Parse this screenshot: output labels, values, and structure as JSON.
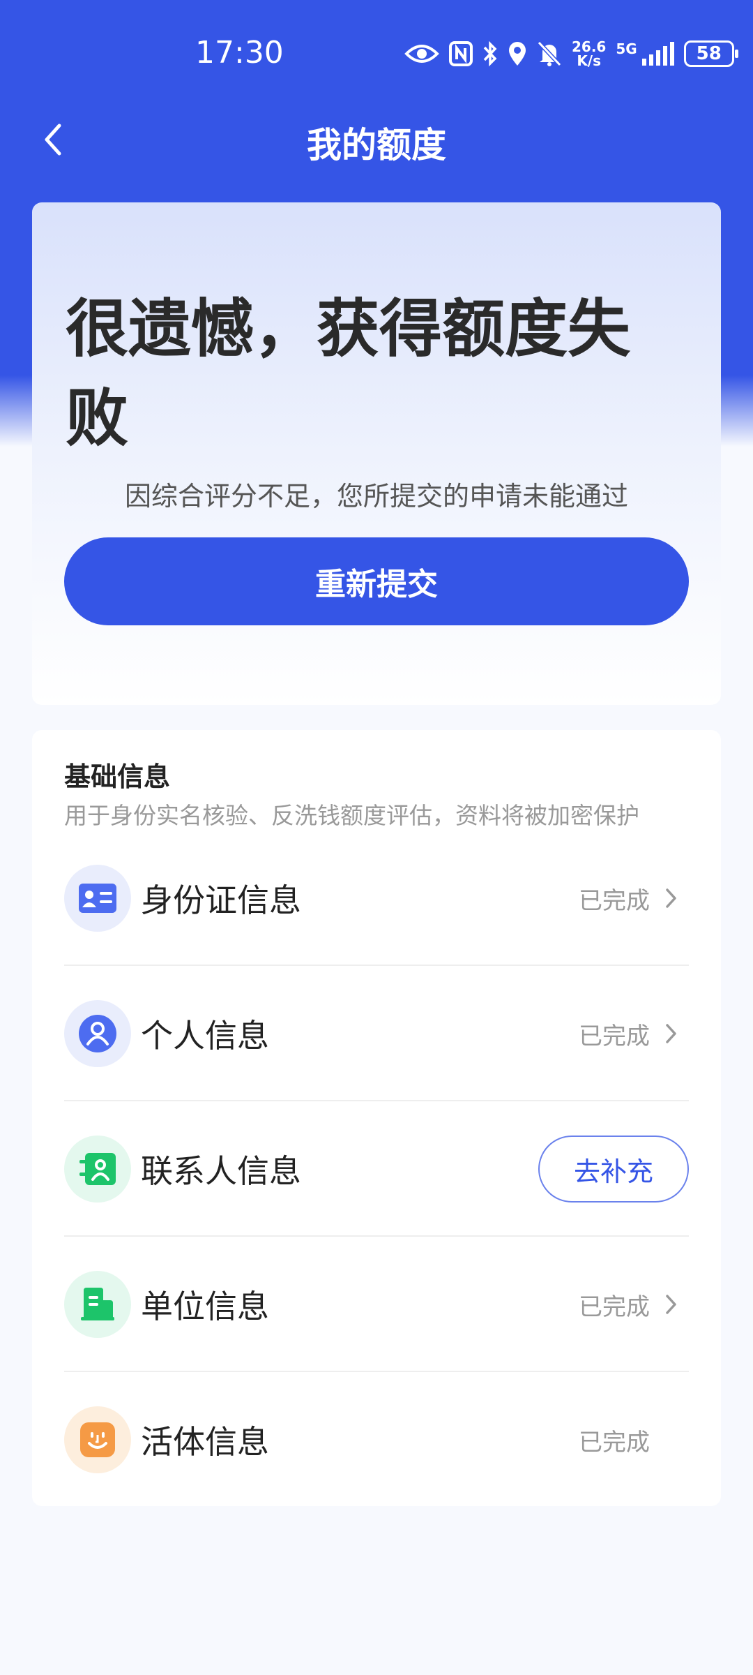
{
  "status_bar": {
    "time": "17:30",
    "net_speed_value": "26.6",
    "net_speed_unit": "K/s",
    "network": "5G",
    "battery": "58",
    "icons": [
      "eye-icon",
      "nfc-icon",
      "bluetooth-icon",
      "location-icon",
      "mute-icon",
      "signal-icon",
      "battery-icon"
    ]
  },
  "header": {
    "title": "我的额度",
    "back_icon": "chevron-left-icon"
  },
  "result": {
    "title": "很遗憾，获得额度失败",
    "subtitle": "因综合评分不足，您所提交的申请未能通过",
    "resubmit_label": "重新提交"
  },
  "basic_info": {
    "title": "基础信息",
    "description": "用于身份实名核验、反洗钱额度评估，资料将被加密保护",
    "items": [
      {
        "label": "身份证信息",
        "status": "已完成",
        "icon": "id-card-icon"
      },
      {
        "label": "个人信息",
        "status": "已完成",
        "icon": "person-icon"
      },
      {
        "label": "联系人信息",
        "action": "去补充",
        "icon": "contacts-icon"
      },
      {
        "label": "单位信息",
        "status": "已完成",
        "icon": "building-icon"
      },
      {
        "label": "活体信息",
        "status": "已完成",
        "icon": "face-icon"
      }
    ]
  },
  "colors": {
    "primary": "#3555e6",
    "icon_blue_bg": "#e9edfc",
    "icon_green_bg": "#e4f8ee",
    "icon_orange_bg": "#fdeedd",
    "green": "#1dc46a",
    "orange": "#f59a45"
  }
}
